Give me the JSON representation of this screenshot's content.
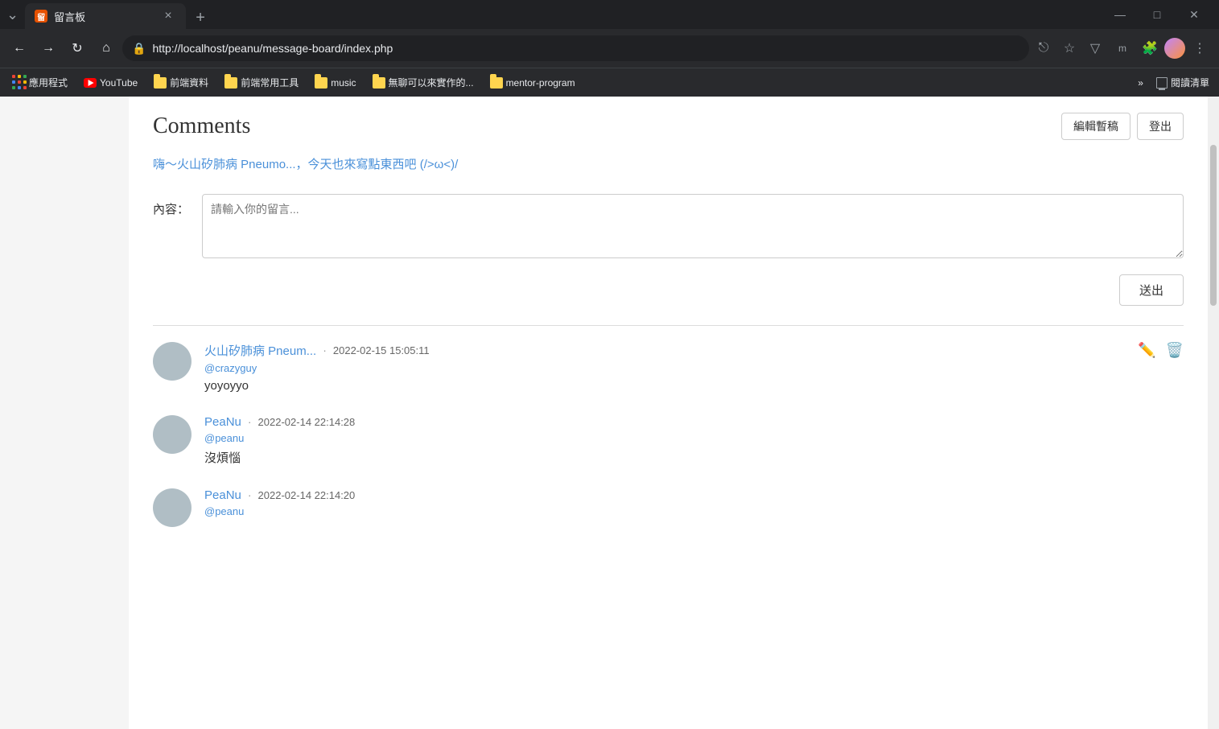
{
  "browser": {
    "tab": {
      "favicon": "留",
      "title": "留言板",
      "close_label": "×"
    },
    "new_tab_label": "+",
    "window_controls": {
      "minimize": "—",
      "maximize": "□",
      "close": "✕",
      "chevron_down": "⌄"
    },
    "nav": {
      "back": "←",
      "forward": "→",
      "reload": "↻",
      "home": "⌂"
    },
    "address": {
      "lock_icon": "🔒",
      "url": "http://localhost/peanu/message-board/index.php"
    },
    "actions": {
      "share": "⎋",
      "bookmark": "☆",
      "downloader": "▽",
      "extensions": "🧩",
      "menu": "⋮"
    },
    "bookmarks": [
      {
        "id": "apps",
        "type": "apps",
        "label": "應用程式"
      },
      {
        "id": "youtube",
        "type": "youtube",
        "label": "YouTube"
      },
      {
        "id": "frontend-data",
        "type": "folder",
        "label": "前端資料"
      },
      {
        "id": "frontend-tools",
        "type": "folder",
        "label": "前端常用工具"
      },
      {
        "id": "music",
        "type": "folder",
        "label": "music"
      },
      {
        "id": "boring",
        "type": "folder",
        "label": "無聊可以來實作的..."
      },
      {
        "id": "mentor",
        "type": "folder",
        "label": "mentor-program"
      }
    ],
    "reading_list_label": "閱讀清單"
  },
  "page": {
    "title": "Comments",
    "header_buttons": {
      "edit_draft": "編輯暫稿",
      "logout": "登出"
    },
    "welcome_message": "嗨～火山矽肺病 Pneumo...，今天也來寫點東西吧 (/>ω<)/",
    "form": {
      "label": "內容：",
      "placeholder": "請輸入你的留言...",
      "submit_label": "送出"
    },
    "comments": [
      {
        "id": "comment-1",
        "author": "火山矽肺病 Pneum...",
        "handle": "@crazyguy",
        "time": "2022-02-15 15:05:11",
        "text": "yoyoyyo",
        "can_edit": true,
        "can_delete": true
      },
      {
        "id": "comment-2",
        "author": "PeaNu",
        "handle": "@peanu",
        "time": "2022-02-14 22:14:28",
        "text": "沒煩惱",
        "can_edit": false,
        "can_delete": false
      },
      {
        "id": "comment-3",
        "author": "PeaNu",
        "handle": "@peanu",
        "time": "2022-02-14 22:14:20",
        "text": "",
        "can_edit": false,
        "can_delete": false
      }
    ]
  }
}
